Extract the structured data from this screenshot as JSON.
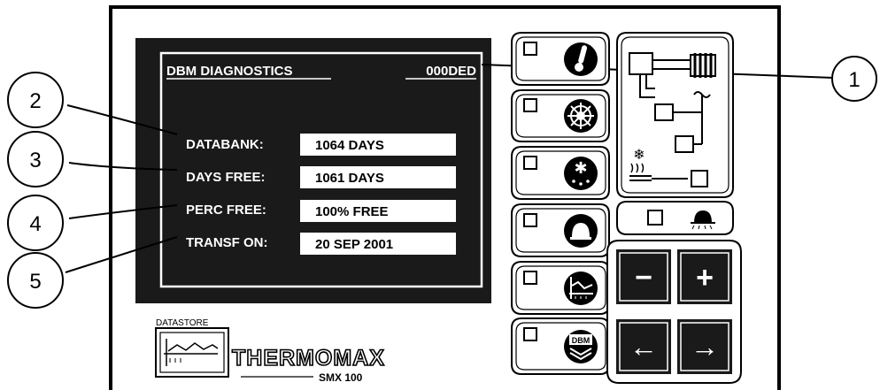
{
  "colors": {
    "screen_bg": "#1a1a1a",
    "frame": "#000000",
    "panel_bg": "#ffffff",
    "value_box": "#ffffff"
  },
  "screen": {
    "title": "DBM DIAGNOSTICS",
    "code": "000DED",
    "rows": [
      {
        "label": "DATABANK:",
        "value": "1064 DAYS"
      },
      {
        "label": "DAYS FREE:",
        "value": "1061 DAYS"
      },
      {
        "label": "PERC FREE:",
        "value": "100% FREE"
      },
      {
        "label": "TRANSF ON:",
        "value": "20 SEP 2001"
      }
    ]
  },
  "callouts": [
    "1",
    "2",
    "3",
    "4",
    "5"
  ],
  "brand": {
    "datastore_label": "DATASTORE",
    "name": "THERMOMAX",
    "model": "SMX 100"
  },
  "mode_buttons": [
    {
      "icon": "thermometer-icon"
    },
    {
      "icon": "defrost-cycle-icon"
    },
    {
      "icon": "manual-defrost-icon"
    },
    {
      "icon": "alarm-bell-icon"
    },
    {
      "icon": "temperature-graph-icon"
    },
    {
      "icon": "dbm-logo-icon",
      "text": "DBM"
    }
  ],
  "indicator_panel": {
    "icons": [
      "evaporator-coil-icon",
      "fan-icon",
      "snowflake-icon",
      "heater-icon"
    ]
  },
  "light_button": {
    "icon": "lamp-icon"
  },
  "keypad": [
    {
      "label": "−",
      "name": "minus-key"
    },
    {
      "label": "+",
      "name": "plus-key"
    },
    {
      "label": "←",
      "name": "left-arrow-key"
    },
    {
      "label": "→",
      "name": "right-arrow-key"
    }
  ]
}
